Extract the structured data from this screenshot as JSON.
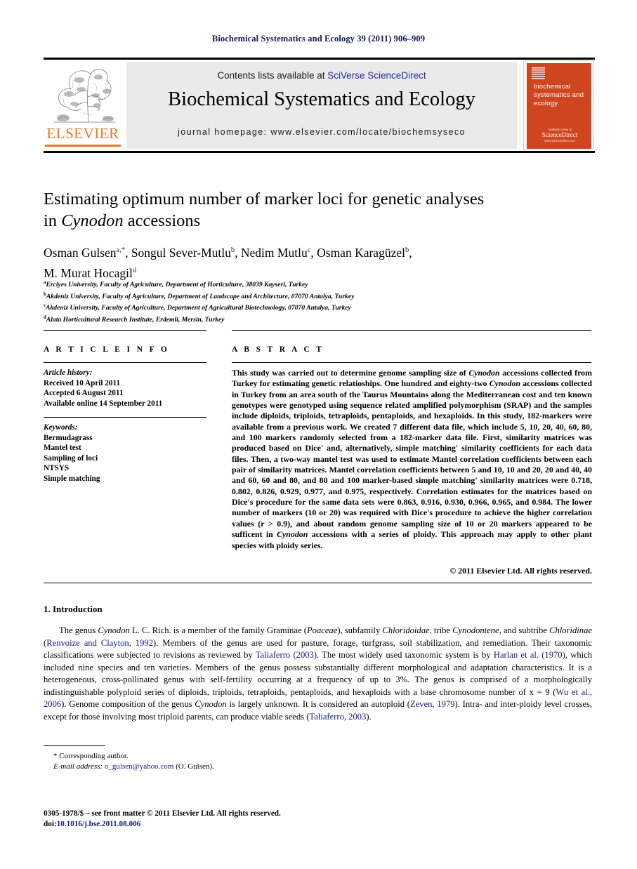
{
  "running_head": "Biochemical Systematics and Ecology 39 (2011) 906–909",
  "masthead": {
    "contents_prefix": "Contents lists available at ",
    "contents_link": "SciVerse ScienceDirect",
    "journal_name": "Biochemical Systematics and Ecology",
    "homepage_label": "journal homepage: www.elsevier.com/locate/biochemsyseco",
    "publisher_wordmark": "ELSEVIER",
    "cover": {
      "title_lines": "biochemical systematics and ecology",
      "footer_small_top": "Available online at",
      "footer_logo": "ScienceDirect",
      "footer_small_bottom": "www.sciencedirect.com"
    }
  },
  "article": {
    "title_line1": "Estimating optimum number of marker loci for genetic analyses",
    "title_line2_pre": "in ",
    "title_line2_italic": "Cynodon",
    "title_line2_post": " accessions",
    "authors": "Osman Gulsen a,*, Songul Sever-Mutlu b, Nedim Mutlu c, Osman Karagüzel b, M. Murat Hocagil d",
    "author_list": [
      {
        "name": "Osman Gulsen",
        "marks": "a,*"
      },
      {
        "name": "Songul Sever-Mutlu",
        "marks": "b"
      },
      {
        "name": "Nedim Mutlu",
        "marks": "c"
      },
      {
        "name": "Osman Karagüzel",
        "marks": "b"
      },
      {
        "name": "M. Murat Hocagil",
        "marks": "d"
      }
    ],
    "affiliations": [
      {
        "mark": "a",
        "text": "Erciyes University, Faculty of Agriculture, Department of Horticulture, 38039 Kayseri, Turkey"
      },
      {
        "mark": "b",
        "text": "Akdeniz University, Faculty of Agriculture, Department of Landscape and Architecture, 07070 Antalya, Turkey"
      },
      {
        "mark": "c",
        "text": "Akdeniz University, Faculty of Agriculture, Department of Agricultural Biotechnology, 07070 Antalya, Turkey"
      },
      {
        "mark": "d",
        "text": "Alata Horticultural Research Institute, Erdemli, Mersin, Turkey"
      }
    ]
  },
  "article_info": {
    "heading": "A R T I C L E   I N F O",
    "history_label": "Article history:",
    "history": [
      "Received 10 April 2011",
      "Accepted 6 August 2011",
      "Available online 14 September 2011"
    ],
    "keywords_label": "Keywords:",
    "keywords": [
      "Bermudagrass",
      "Mantel test",
      "Sampling of loci",
      "NTSYS",
      "Simple matching"
    ]
  },
  "abstract": {
    "heading": "A B S T R A C T",
    "part1": "This study was carried out to determine genome sampling size of ",
    "italic1": "Cynodon",
    "part2": " accessions collected from Turkey for estimating genetic relatioships. One hundred and eighty-two ",
    "italic2": "Cynodon",
    "part3": " accessions collected in Turkey from an area south of the Taurus Mountains along the Mediterranean cost and ten known genotypes were genotyped using sequence related amplified polymorphism (SRAP) and the samples include diploids, triploids, tetraploids, pentaploids, and hexaploids. In this study, 182-markers were available from a previous work. We created 7 different data file, which include 5, 10, 20, 40, 60, 80, and 100 markers randomly selected from a 182-marker data file. First, similarity matrices was produced based on Dice' and, alternatively, simple matching' similarity coefficients for each data files. Then, a two-way mantel test was used to estimate Mantel correlation coefficients between each pair of similarity matrices. Mantel correlation coefficients between 5 and 10, 10 and 20, 20 and 40, 40 and 60, 60 and 80, and 80 and 100 marker-based simple matching' similarity matrices were 0.718, 0.802, 0.826, 0.929, 0.977, and 0.975, respectively. Correlation estimates for the matrices based on Dice's procedure for the same data sets were 0.863, 0.916, 0.930, 0.966, 0.965, and 0.984. The lower number of markers (10 or 20) was required with Dice's procedure to achieve the higher correlation values (r > 0.9), and about random genome sampling size of 10 or 20 markers appeared to be sufficent in ",
    "italic3": "Cynodon",
    "part4": " accessions with a series of ploidy. This approach may apply to other plant species with ploidy series.",
    "copyright": "© 2011 Elsevier Ltd. All rights reserved."
  },
  "introduction": {
    "heading": "1. Introduction",
    "p1_a": "The genus ",
    "p1_i1": "Cynodon",
    "p1_b": " L. C. Rich. is a member of the family Graminae (",
    "p1_i2": "Poaceae",
    "p1_c": "), subfamily ",
    "p1_i3": "Chloridoidae",
    "p1_d": ", tribe ",
    "p1_i4": "Cynodontene",
    "p1_e": ", and subtribe ",
    "p1_i5": "Chloridinae",
    "p1_f": " (",
    "ref1": "Renvoize and Clayton, 1992",
    "p1_g": "). Members of the genus are used for pasture, forage, turfgrass, soil stabilization, and remediation. Their taxonomic classifications were subjected to revisions as reviewed by ",
    "ref2": "Taliaferro (2003)",
    "p1_h": ". The most widely used taxonomic system is by ",
    "ref3": "Harlan et al. (1970)",
    "p1_i": ", which included nine species and ten varieties. Members of the genus possess substantially different morphological and adaptation characteristics. It is a heterogeneous, cross-pollinated genus with self-fertility occurring at a frequency of up to 3%. The genus is comprised of a morphologically indistinguishable polyploid series of diploids, triploids, tetraploids, pentaploids, and hexaploids with a base chromosome number of x = 9 (",
    "ref4": "Wu et al., 2006",
    "p1_j": "). Genome composition of the genus ",
    "p1_i6": "Cynodon",
    "p1_k": " is largely unknown. It is considered an autoploid (",
    "ref5": "Zeven, 1979",
    "p1_l": "). Intra- and inter-ploidy level crosses, except for those involving most triploid parents, can produce viable seeds (",
    "ref6": "Taliaferro, 2003",
    "p1_m": ")."
  },
  "footnotes": {
    "corresponding": "* Corresponding author.",
    "email_label": "E-mail address:",
    "email": "o_gulsen@yahoo.com",
    "email_suffix": " (O. Gulsen)."
  },
  "imprint": {
    "line1": "0305-1978/$ – see front matter © 2011 Elsevier Ltd. All rights reserved.",
    "doi_label": "doi:",
    "doi": "10.1016/j.bse.2011.08.006"
  },
  "colors": {
    "running_head": "#111a5c",
    "link_blue": "#2a2aa5",
    "ref_blue": "#111a7e",
    "elsevier_orange": "#e87722",
    "cover_orange": "#cf4520",
    "panel_grey": "#eaeaea"
  }
}
